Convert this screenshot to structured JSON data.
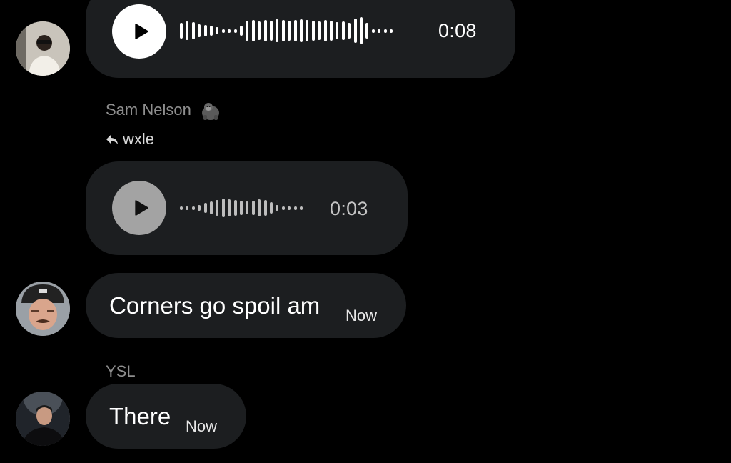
{
  "messages": [
    {
      "type": "voice",
      "duration": "0:08",
      "played": false
    },
    {
      "type": "voice",
      "sender": "Sam Nelson",
      "reply_to": "wxle",
      "duration": "0:03",
      "played": true
    },
    {
      "type": "text",
      "text": "Corners go spoil am",
      "time": "Now"
    },
    {
      "type": "text",
      "sender": "YSL",
      "text": "There",
      "time": "Now"
    }
  ],
  "icons": {
    "play": "play-icon",
    "reply": "reply-arrow-icon",
    "sender_emoji": "gorilla-emoji-icon"
  },
  "colors": {
    "background": "#000000",
    "bubble": "#1c1e20",
    "waveform_active": "#ffffff",
    "waveform_played": "#bdbdbd",
    "meta_text": "#8e8e8e"
  }
}
